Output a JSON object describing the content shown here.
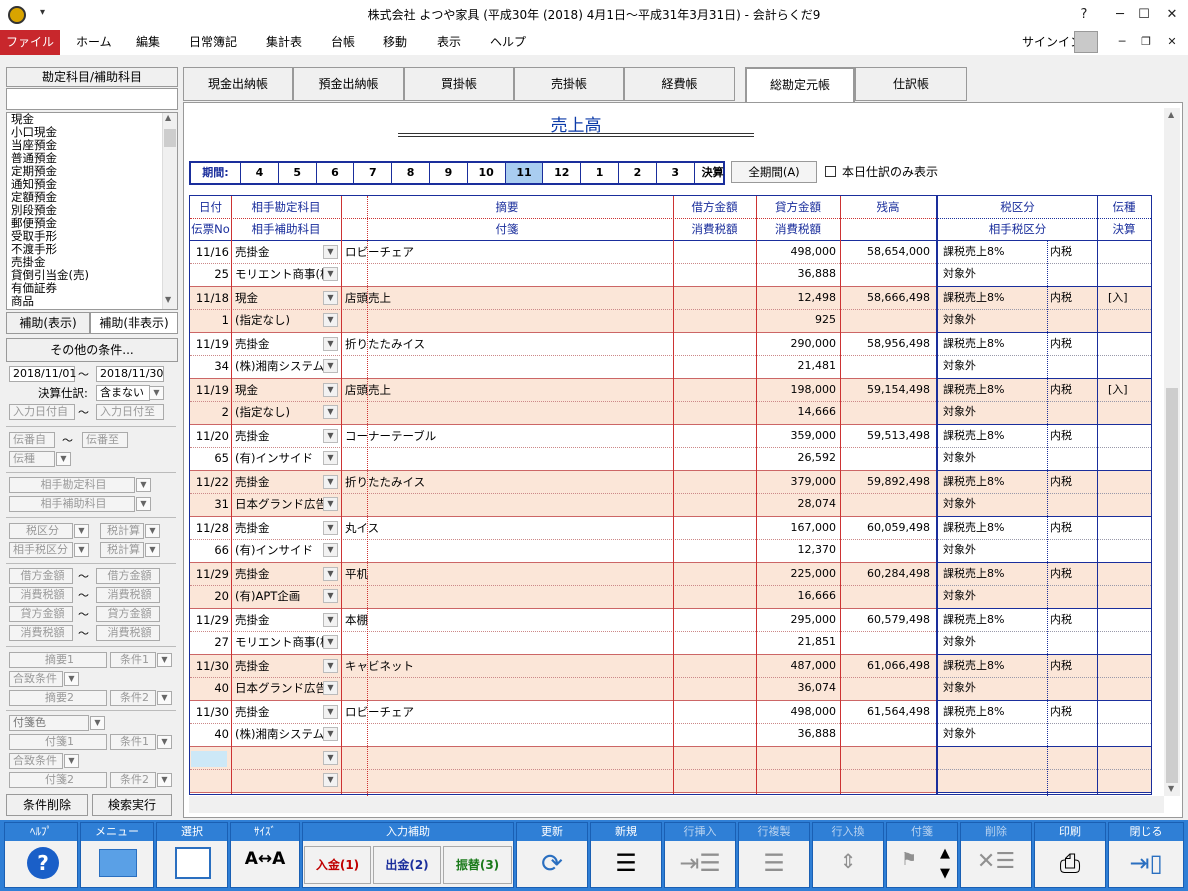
{
  "window": {
    "title": "株式会社 よつや家具 (平成30年 (2018) 4月1日～平成31年3月31日) - 会計らくだ9",
    "controls": [
      "?",
      "─",
      "☐",
      "✕"
    ],
    "signin": "サインイン"
  },
  "menu": [
    "ファイル",
    "ホーム",
    "編集",
    "日常簿記",
    "集計表",
    "台帳",
    "移動",
    "表示",
    "ヘルプ"
  ],
  "sidebar": {
    "title": "勘定科目/補助科目",
    "accounts": [
      "現金",
      "小口現金",
      "当座預金",
      "普通預金",
      "定期預金",
      "通知預金",
      "定額預金",
      "別段預金",
      "郵便預金",
      "受取手形",
      "不渡手形",
      "売掛金",
      "貸倒引当金(売)",
      "有価証券",
      "商品"
    ],
    "tab_show": "補助(表示)",
    "tab_hide": "補助(非表示)",
    "other_conditions": "その他の条件...",
    "date_from": "2018/11/01",
    "date_to": "2018/11/30",
    "tilde": "～",
    "settle_label": "決算仕訳:",
    "settle_value": "含まない",
    "input_date_from": "入力日付自",
    "input_date_to": "入力日付至",
    "voucher_from": "伝番自",
    "voucher_to": "伝番至",
    "voucher_type": "伝種",
    "partner_account": "相手勘定科目",
    "partner_sub": "相手補助科目",
    "tax_class": "税区分",
    "tax_calc": "税計算",
    "partner_tax": "相手税区分",
    "tax_calc2": "税計算",
    "debit_from": "借方金額",
    "debit_to": "借方金額",
    "tax_from": "消費税額",
    "tax_to": "消費税額",
    "credit_from": "貸方金額",
    "credit_to": "貸方金額",
    "tax2_from": "消費税額",
    "tax2_to": "消費税額",
    "summary1": "摘要1",
    "cond1": "条件1",
    "match1": "合致条件",
    "summary2": "摘要2",
    "cond2": "条件2",
    "tag_color": "付箋色",
    "tag1": "付箋1",
    "tcond1": "条件1",
    "tmatch": "合致条件",
    "tag2": "付箋2",
    "tcond2": "条件2",
    "clear": "条件削除",
    "search": "検索実行"
  },
  "tabs": [
    "現金出納帳",
    "預金出納帳",
    "買掛帳",
    "売掛帳",
    "経費帳",
    "総勘定元帳",
    "仕訳帳"
  ],
  "ledger": {
    "title": "売上高",
    "period_label": "期間:",
    "months": [
      "4",
      "5",
      "6",
      "7",
      "8",
      "9",
      "10",
      "11",
      "12",
      "1",
      "2",
      "3",
      "決算"
    ],
    "selected_month": "11",
    "all_period": "全期間(A)",
    "today_only": "本日仕訳のみ表示",
    "headers": {
      "date": "日付",
      "partner": "相手勘定科目",
      "summary": "摘要",
      "debit": "借方金額",
      "credit": "貸方金額",
      "balance": "残高",
      "tax": "税区分",
      "vtype": "伝種",
      "vno": "伝票No",
      "psub": "相手補助科目",
      "tag": "付箋",
      "dtax": "消費税額",
      "ctax": "消費税額",
      "ptax": "相手税区分",
      "settle": "決算"
    },
    "rows": [
      {
        "date": "11/16",
        "no": "25",
        "acct": "売掛金",
        "sub": "モリエント商事(株",
        "summary": "ロビーチェア",
        "credit": "498,000",
        "ctax": "36,888",
        "balance": "58,654,000",
        "tax": "課税売上8%",
        "incl": "内税",
        "ptax": "対象外",
        "vtype": ""
      },
      {
        "date": "11/18",
        "no": "1",
        "acct": "現金",
        "sub": "(指定なし)",
        "summary": "店頭売上",
        "credit": "12,498",
        "ctax": "925",
        "balance": "58,666,498",
        "tax": "課税売上8%",
        "incl": "内税",
        "ptax": "対象外",
        "vtype": "[入]"
      },
      {
        "date": "11/19",
        "no": "34",
        "acct": "売掛金",
        "sub": "(株)湘南システム",
        "summary": "折りたたみイス",
        "credit": "290,000",
        "ctax": "21,481",
        "balance": "58,956,498",
        "tax": "課税売上8%",
        "incl": "内税",
        "ptax": "対象外",
        "vtype": ""
      },
      {
        "date": "11/19",
        "no": "2",
        "acct": "現金",
        "sub": "(指定なし)",
        "summary": "店頭売上",
        "credit": "198,000",
        "ctax": "14,666",
        "balance": "59,154,498",
        "tax": "課税売上8%",
        "incl": "内税",
        "ptax": "対象外",
        "vtype": "[入]"
      },
      {
        "date": "11/20",
        "no": "65",
        "acct": "売掛金",
        "sub": "(有)インサイド",
        "summary": "コーナーテーブル",
        "credit": "359,000",
        "ctax": "26,592",
        "balance": "59,513,498",
        "tax": "課税売上8%",
        "incl": "内税",
        "ptax": "対象外",
        "vtype": ""
      },
      {
        "date": "11/22",
        "no": "31",
        "acct": "売掛金",
        "sub": "日本グランド広告",
        "summary": "折りたたみイス",
        "credit": "379,000",
        "ctax": "28,074",
        "balance": "59,892,498",
        "tax": "課税売上8%",
        "incl": "内税",
        "ptax": "対象外",
        "vtype": ""
      },
      {
        "date": "11/28",
        "no": "66",
        "acct": "売掛金",
        "sub": "(有)インサイド",
        "summary": "丸イス",
        "credit": "167,000",
        "ctax": "12,370",
        "balance": "60,059,498",
        "tax": "課税売上8%",
        "incl": "内税",
        "ptax": "対象外",
        "vtype": ""
      },
      {
        "date": "11/29",
        "no": "20",
        "acct": "売掛金",
        "sub": "(有)APT企画",
        "summary": "平机",
        "credit": "225,000",
        "ctax": "16,666",
        "balance": "60,284,498",
        "tax": "課税売上8%",
        "incl": "内税",
        "ptax": "対象外",
        "vtype": ""
      },
      {
        "date": "11/29",
        "no": "27",
        "acct": "売掛金",
        "sub": "モリエント商事(株",
        "summary": "本棚",
        "credit": "295,000",
        "ctax": "21,851",
        "balance": "60,579,498",
        "tax": "課税売上8%",
        "incl": "内税",
        "ptax": "対象外",
        "vtype": ""
      },
      {
        "date": "11/30",
        "no": "40",
        "acct": "売掛金",
        "sub": "日本グランド広告",
        "summary": "キャビネット",
        "credit": "487,000",
        "ctax": "36,074",
        "balance": "61,066,498",
        "tax": "課税売上8%",
        "incl": "内税",
        "ptax": "対象外",
        "vtype": ""
      },
      {
        "date": "11/30",
        "no": "40",
        "acct": "売掛金",
        "sub": "(株)湘南システム",
        "summary": "ロビーチェア",
        "credit": "498,000",
        "ctax": "36,888",
        "balance": "61,564,498",
        "tax": "課税売上8%",
        "incl": "内税",
        "ptax": "対象外",
        "vtype": ""
      }
    ]
  },
  "toolbar": {
    "help": "ﾍﾙﾌﾟ",
    "menu": "メニュー",
    "select": "選択",
    "size": "ｻｲｽﾞ",
    "input_assist": "入力補助",
    "deposit": "入金(1)",
    "withdraw": "出金(2)",
    "transfer": "振替(3)",
    "refresh": "更新",
    "new": "新規",
    "row_insert": "行挿入",
    "row_copy": "行複製",
    "row_swap": "行入換",
    "tag": "付箋",
    "delete": "削除",
    "print": "印刷",
    "close": "閉じる"
  },
  "colors": {
    "accent": "#2f7fd6",
    "file_menu": "#c8272c",
    "grid_line": "#1a2e9c",
    "pink_row": "#fbe6d8",
    "red_text": "#c00000",
    "green_text": "#1b7a1b"
  }
}
